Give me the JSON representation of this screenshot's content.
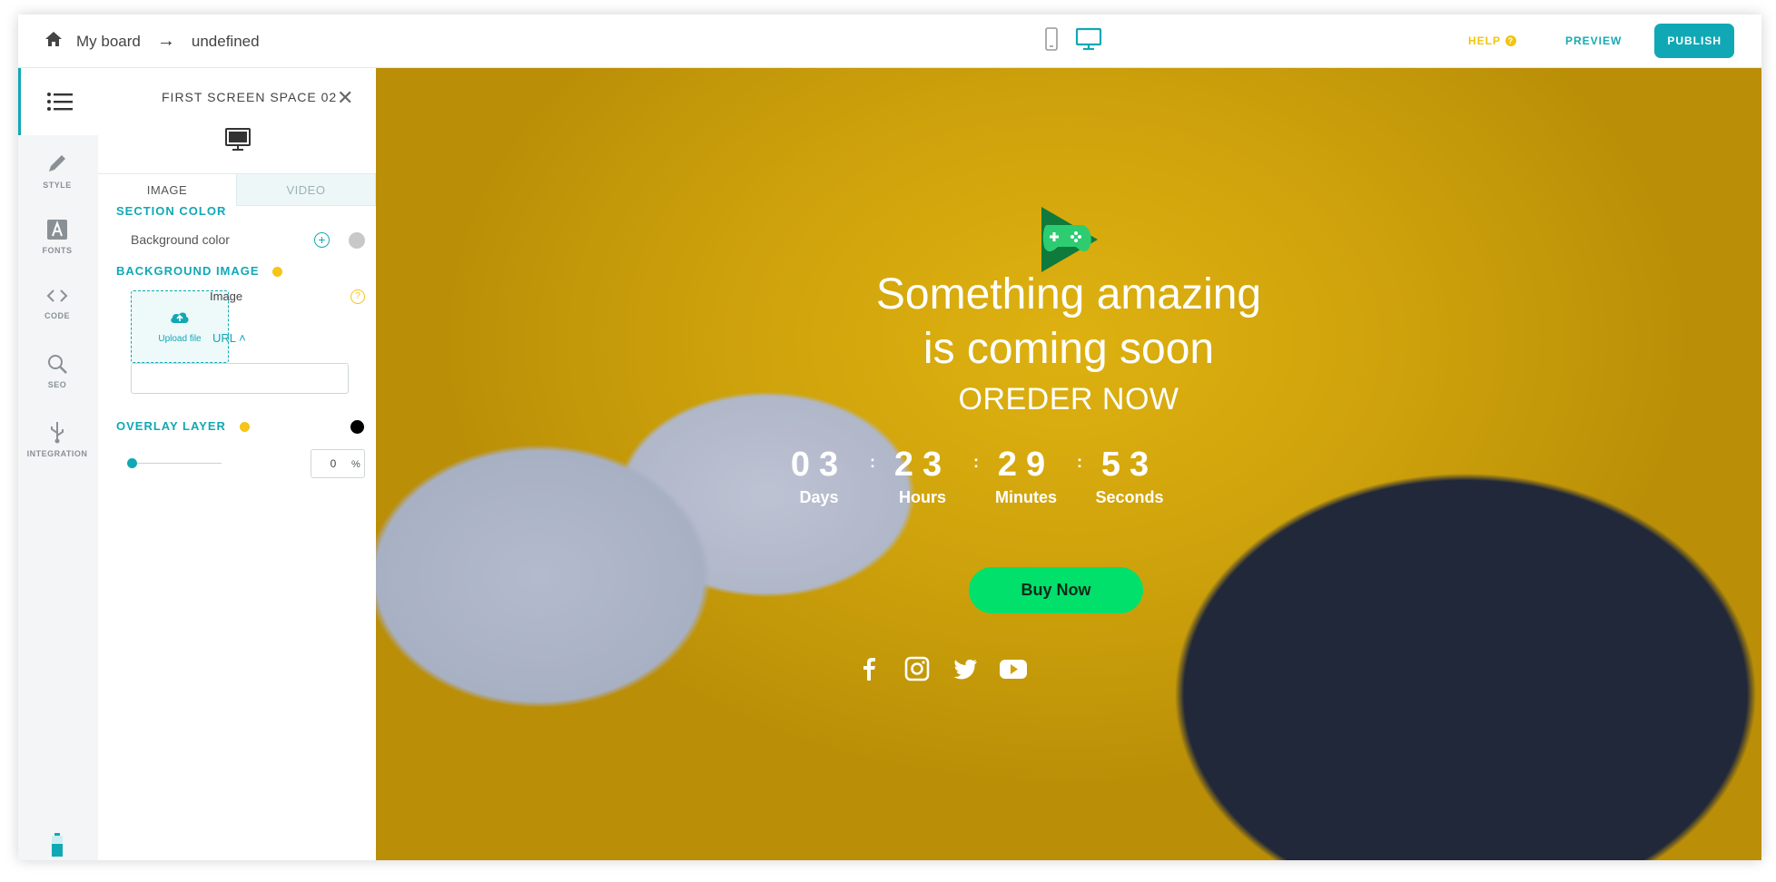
{
  "topbar": {
    "home_icon": "home-icon",
    "board": "My board",
    "arrow": "→",
    "page": "undefined",
    "help": "HELP",
    "help_q": "?",
    "preview": "PREVIEW",
    "publish": "PUBLISH"
  },
  "rail": {
    "items": [
      {
        "label": "STYLE",
        "icon": "pencil-icon"
      },
      {
        "label": "FONTS",
        "icon": "font-icon"
      },
      {
        "label": "CODE",
        "icon": "code-icon"
      },
      {
        "label": "SEO",
        "icon": "search-icon"
      },
      {
        "label": "INTEGRATION",
        "icon": "usb-icon"
      }
    ]
  },
  "panel": {
    "title": "FIRST SCREEN SPACE 02",
    "close": "✕",
    "tabs": [
      "IMAGE",
      "VIDEO"
    ],
    "section_color": "SECTION COLOR",
    "bg_color_label": "Background color",
    "plus": "+",
    "background_image": "BACKGROUND IMAGE",
    "image_label": "Image",
    "qmark": "?",
    "upload_label": "Upload file",
    "url_label": "URL ˄",
    "url_value": "",
    "overlay_layer": "OVERLAY LAYER",
    "overlay_value": "0",
    "overlay_pct": "%"
  },
  "colors": {
    "accent": "#11a8b5",
    "help": "#f1c40f",
    "buy": "#00e06b",
    "background_swatch": "#c8c8c8",
    "overlay_swatch": "#000000"
  },
  "hero": {
    "logo": "game-controller-logo-icon",
    "title_line1": "Something amazing",
    "title_line2": "is coming soon",
    "subtitle": "OREDER NOW",
    "countdown": [
      {
        "value": "03",
        "label": "Days"
      },
      {
        "value": "23",
        "label": "Hours"
      },
      {
        "value": "29",
        "label": "Minutes"
      },
      {
        "value": "53",
        "label": "Seconds"
      }
    ],
    "separator": ":",
    "buy": "Buy Now",
    "social": [
      "facebook-icon",
      "instagram-icon",
      "twitter-icon",
      "youtube-icon"
    ]
  }
}
